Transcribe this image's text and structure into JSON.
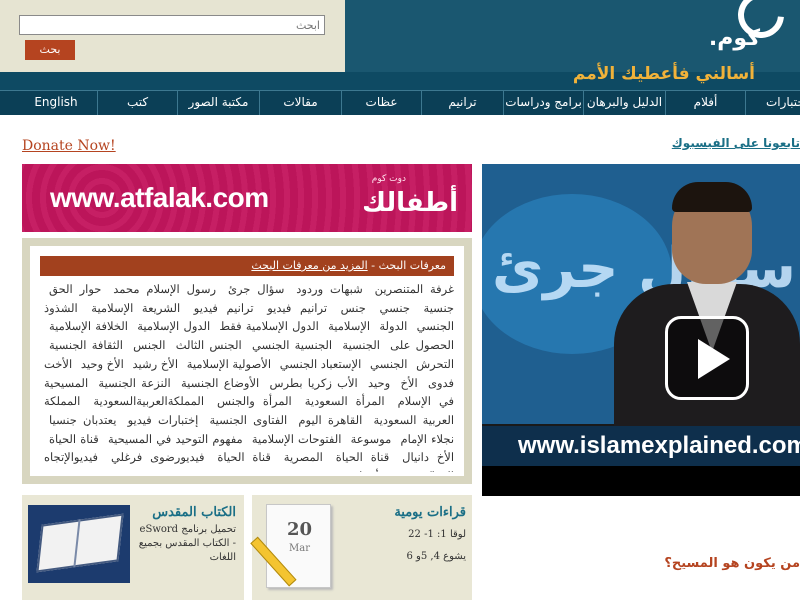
{
  "header": {
    "search": {
      "placeholder": "ابحث",
      "button": "بحث"
    },
    "logo": "كوم.",
    "slogan": "أسالني فأعطيك الأمم"
  },
  "nav": [
    {
      "label": "English"
    },
    {
      "label": "كتب"
    },
    {
      "label": "مكتبة الصور"
    },
    {
      "label": "مقالات"
    },
    {
      "label": "عظات"
    },
    {
      "label": "ترانيم"
    },
    {
      "label": "برامج ودراسات"
    },
    {
      "label": "الدليل والبرهان"
    },
    {
      "label": "أفلام"
    },
    {
      "label": "اختبارات"
    }
  ],
  "left": {
    "donate": "Donate Now!",
    "banner": {
      "url": "www.atfalak.com",
      "logo_text": "أطفالك",
      "logo_sub": "دوت كوم"
    },
    "tags": {
      "title": "معرفات البحث - ",
      "more": "المزيد من معرفات البحث",
      "items": [
        "غرفة المتنصرين",
        "شبهات وردود",
        "سؤال جرئ",
        "رسول الإسلام محمد",
        "حوار الحق",
        "جنسية",
        "جنسي",
        "جنس",
        "ترانيم فيديو",
        "ترانيم فيديو",
        "الشريعة الإسلامية",
        "الشذوذ الجنسي",
        "الدولة",
        "الإسلامية",
        "الدول الإسلامية فقط",
        "الدول الإسلامية",
        "الخلافة الإسلامية",
        "الحصول على",
        "الجنسية",
        "الجنسية الجنسي",
        "الجنس الثالث",
        "الجنس",
        "الثقافة الجنسية",
        "التحرش",
        "الجنسي",
        "الإستعباد الجنسي",
        "الأصولية الإسلامية",
        "الأخ رشيد",
        "الأخ وحيد",
        "الأخت فدوى",
        "الأخ",
        "وحيد",
        "الأب زكريا بطرس",
        "الأوضاع الجنسية",
        "النزعة الجنسية",
        "المسيحية في الإسلام",
        "المرأة السعودية",
        "المرأة والجنس",
        "المملكةالعربيةالسعودية",
        "المملكة العربية السعودية",
        "القاهرة اليوم",
        "الفتاوى الجنسية",
        "إختبارات فيديو",
        "يعتدبان جنسيا",
        "نجلاء الإمام",
        "موسوعة",
        "الفتوحات الإسلامية",
        "مفهوم التوحيد في المسيحية",
        "قناة الحياة",
        "الأخ دانيال",
        "قناة الحياة",
        "المصرية",
        "قناة الحياة",
        "فيديورضوى فرغلي",
        "فيديوالإتجاه المعاكس",
        "فيديوأحداث",
        "فيديو"
      ]
    },
    "bible": {
      "title": "الكتاب المقدس",
      "desc": "تحميل برنامج eSword - الكتاب المقدس بجميع اللغات"
    },
    "daily": {
      "title": "قراءات يومية",
      "day": "20",
      "month": "Mar",
      "line1": "لوقا 1: 1- 22",
      "line2": "يشوع 4, 5و 6"
    }
  },
  "right": {
    "facebook_link": "تابعونا على الفيسبوك",
    "video": {
      "title_ar": "سؤال جرئ",
      "url": "www.islamexplained.com"
    },
    "question": "من يكون هو المسيح؟"
  },
  "colors": {
    "header_bg": "#1a5770",
    "nav_bg": "#0b3f56",
    "accent": "#b54420",
    "link": "#1a6f86",
    "slogan": "#f0b23a",
    "banner": "#c2185b",
    "panel": "#e9e7d5"
  }
}
